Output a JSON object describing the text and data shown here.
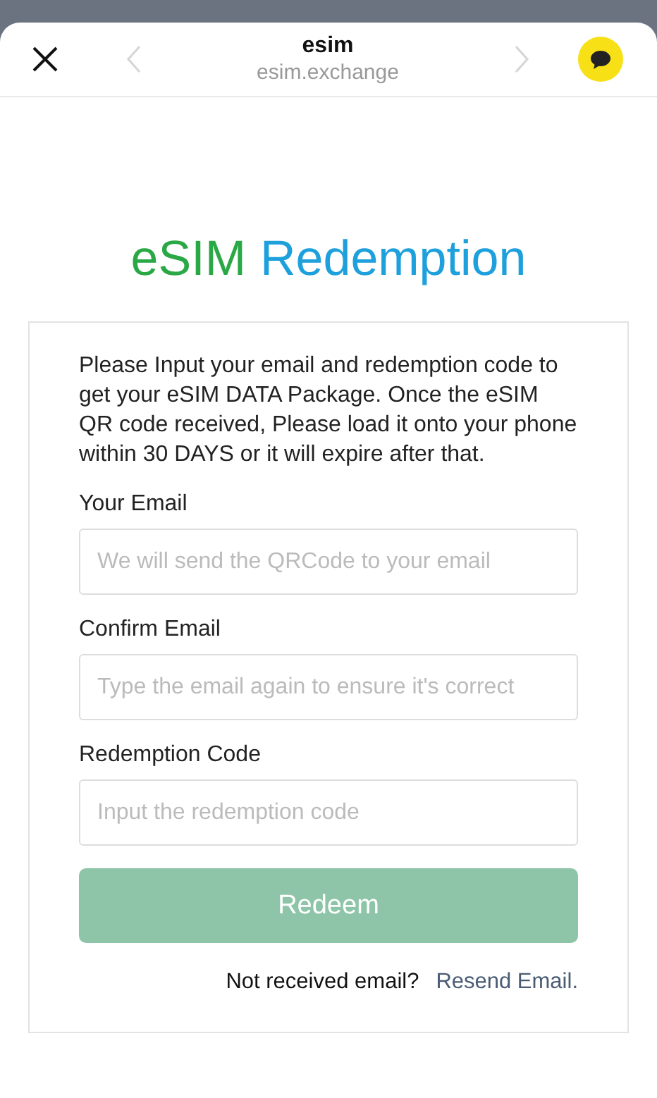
{
  "browser": {
    "title": "esim",
    "url": "esim.exchange",
    "back_disabled": true,
    "forward_disabled": true
  },
  "heading": {
    "parts": [
      {
        "text": "eSIM",
        "color": "#2aa845"
      },
      {
        "text": "Redemption",
        "color": "#1ea0dc"
      }
    ]
  },
  "intro": "Please Input your email and redemption code to get your eSIM DATA Package. Once the eSIM QR code received, Please load it onto your phone within 30 DAYS or it will expire after that.",
  "fields": [
    {
      "label": "Your Email",
      "placeholder": "We will send the QRCode to your email"
    },
    {
      "label": "Confirm Email",
      "placeholder": "Type the email again to ensure it's correct"
    },
    {
      "label": "Redemption Code",
      "placeholder": "Input the redemption code"
    }
  ],
  "submit": {
    "label": "Redeem",
    "disabled": true
  },
  "resend": {
    "prompt": "Not received email?",
    "link": "Resend Email."
  }
}
